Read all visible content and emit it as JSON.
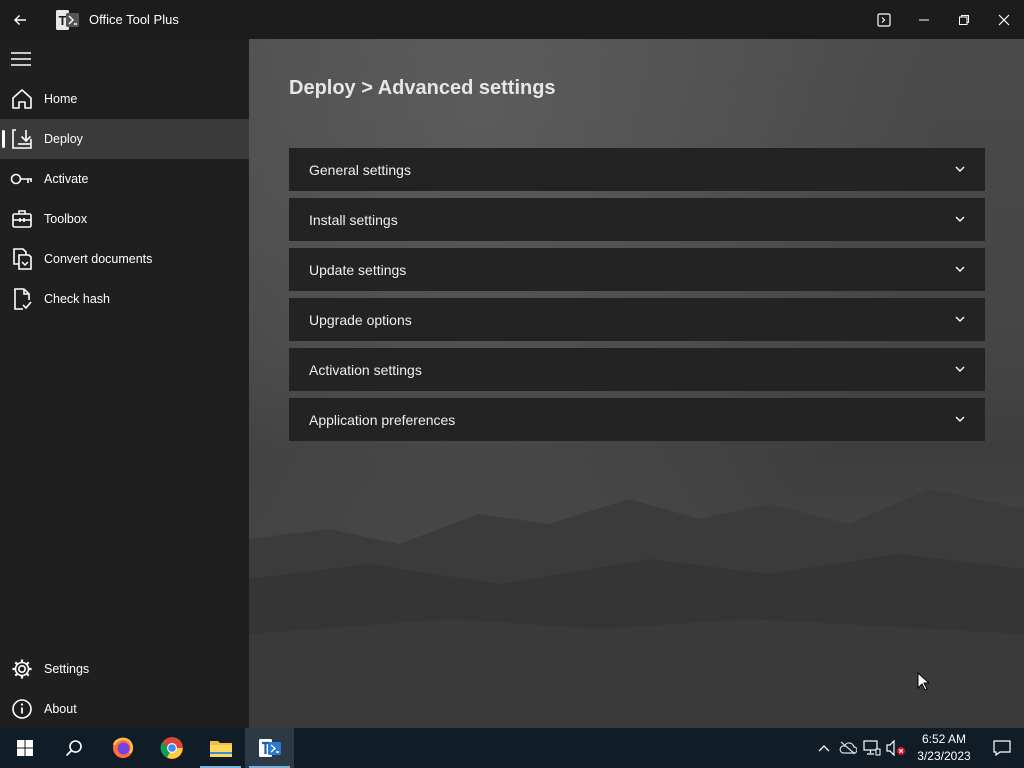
{
  "window": {
    "title": "Office Tool Plus",
    "logo_letter": "T"
  },
  "sidebar": {
    "items": [
      {
        "label": "Home",
        "icon": "home-icon"
      },
      {
        "label": "Deploy",
        "icon": "deploy-icon",
        "active": true
      },
      {
        "label": "Activate",
        "icon": "key-icon"
      },
      {
        "label": "Toolbox",
        "icon": "toolbox-icon"
      },
      {
        "label": "Convert documents",
        "icon": "convert-documents-icon"
      },
      {
        "label": "Check hash",
        "icon": "check-hash-icon"
      }
    ],
    "bottom_items": [
      {
        "label": "Settings",
        "icon": "gear-icon"
      },
      {
        "label": "About",
        "icon": "info-icon"
      }
    ]
  },
  "main": {
    "breadcrumb": "Deploy > Advanced settings",
    "panels": [
      {
        "label": "General settings"
      },
      {
        "label": "Install settings"
      },
      {
        "label": "Update settings"
      },
      {
        "label": "Upgrade options"
      },
      {
        "label": "Activation settings"
      },
      {
        "label": "Application preferences"
      }
    ]
  },
  "taskbar": {
    "apps": [
      "start-icon",
      "search-icon",
      "firefox-icon",
      "chrome-icon",
      "file-explorer-icon",
      "office-tool-plus-icon"
    ],
    "clock": {
      "time": "6:52 AM",
      "date": "3/23/2023"
    }
  },
  "colors": {
    "sidebar_bg": "#1f1f1f",
    "active_item_bg": "#3a3a3a",
    "panel_bg": "#232323",
    "taskbar_bg": "#101c26"
  }
}
